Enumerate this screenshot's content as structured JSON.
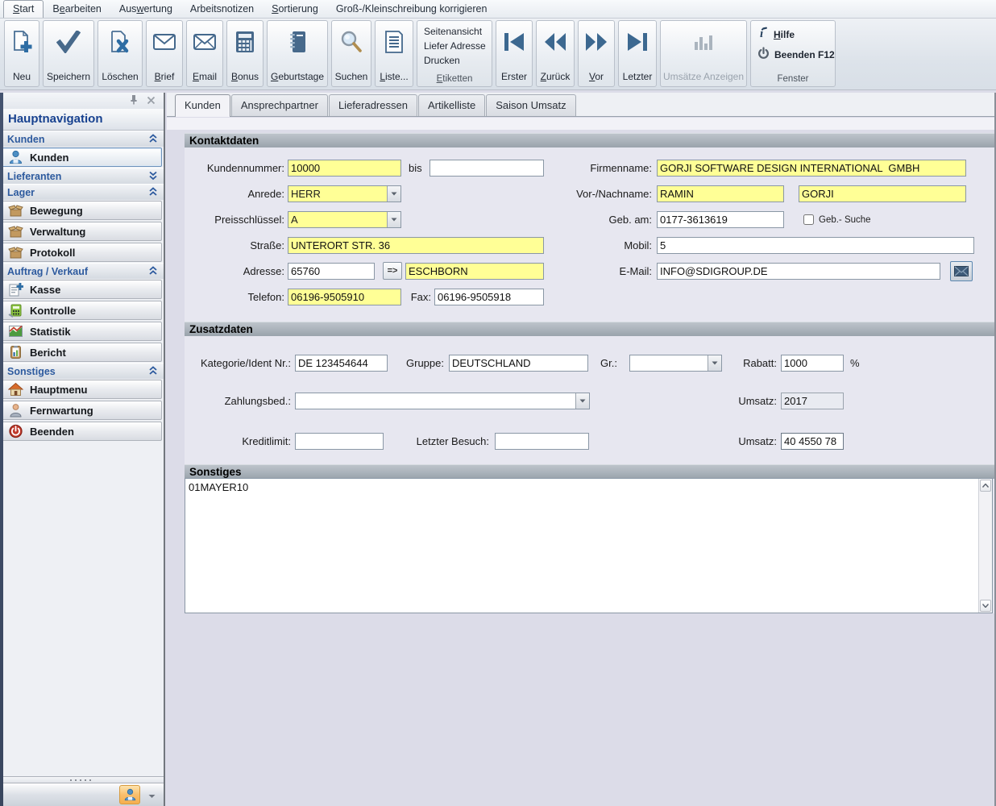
{
  "menubar": {
    "tabs": [
      {
        "pre": "",
        "u": "S",
        "post": "tart"
      },
      {
        "pre": "B",
        "u": "e",
        "post": "arbeiten"
      },
      {
        "pre": "Aus",
        "u": "w",
        "post": "ertung"
      },
      {
        "pre": "Arbeitsnotizen",
        "u": "",
        "post": ""
      },
      {
        "pre": "",
        "u": "S",
        "post": "ortierung"
      },
      {
        "pre": "Groß-/Kleinschreibung korrigieren",
        "u": "",
        "post": ""
      }
    ]
  },
  "ribbon": {
    "buttons": [
      {
        "pre": "Neu",
        "u": "",
        "post": ""
      },
      {
        "pre": "Speichern",
        "u": "",
        "post": ""
      },
      {
        "pre": "Löschen",
        "u": "",
        "post": ""
      },
      {
        "pre": "",
        "u": "B",
        "post": "rief"
      },
      {
        "pre": "",
        "u": "E",
        "post": "mail"
      },
      {
        "pre": "",
        "u": "B",
        "post": "onus"
      },
      {
        "pre": "",
        "u": "G",
        "post": "eburtstage"
      },
      {
        "pre": "Suchen",
        "u": "",
        "post": ""
      },
      {
        "pre": "",
        "u": "L",
        "post": "iste..."
      }
    ],
    "etiketten_group": {
      "items": [
        "Seitenansicht",
        "Liefer Adresse",
        "Drucken"
      ],
      "caption": {
        "pre": "",
        "u": "E",
        "post": "tiketten"
      }
    },
    "nav": [
      {
        "pre": "Erster",
        "u": "",
        "post": ""
      },
      {
        "pre": "",
        "u": "Z",
        "post": "urück"
      },
      {
        "pre": "",
        "u": "V",
        "post": "or"
      },
      {
        "pre": "Letzter",
        "u": "",
        "post": ""
      }
    ],
    "umsaetze_label": "Umsätze Anzeigen",
    "fenster_group": {
      "items": [
        {
          "pre": "",
          "u": "H",
          "post": "ilfe"
        },
        {
          "pre": "Beenden F12",
          "u": "",
          "post": ""
        }
      ],
      "caption": "Fenster"
    }
  },
  "sidebar": {
    "title": "Hauptnavigation",
    "groups": [
      {
        "header": "Kunden",
        "collapsed": false,
        "items": [
          {
            "label": "Kunden"
          }
        ]
      },
      {
        "header": "Lieferanten",
        "collapsed": true,
        "items": []
      },
      {
        "header": "Lager",
        "collapsed": false,
        "items": [
          {
            "label": "Bewegung"
          },
          {
            "label": "Verwaltung"
          },
          {
            "label": "Protokoll"
          }
        ]
      },
      {
        "header": "Auftrag / Verkauf",
        "collapsed": false,
        "items": [
          {
            "label": "Kasse"
          },
          {
            "label": "Kontrolle"
          },
          {
            "label": "Statistik"
          },
          {
            "label": "Bericht"
          }
        ]
      },
      {
        "header": "Sonstiges",
        "collapsed": false,
        "items": [
          {
            "label": "Hauptmenu"
          },
          {
            "label": "Fernwartung"
          },
          {
            "label": "Beenden"
          }
        ]
      }
    ]
  },
  "tabs": {
    "items": [
      "Kunden",
      "Ansprechpartner",
      "Lieferadressen",
      "Artikelliste",
      "Saison Umsatz"
    ],
    "active": "Kunden"
  },
  "form": {
    "sections": {
      "kontaktdaten": "Kontaktdaten",
      "zusatzdaten": "Zusatzdaten",
      "sonstiges": "Sonstiges"
    },
    "labels": {
      "kundennummer": "Kundennummer:",
      "bis": "bis",
      "anrede": "Anrede:",
      "preisschluessel": "Preisschlüssel:",
      "strasse": "Straße:",
      "adresse": "Adresse:",
      "telefon": "Telefon:",
      "fax": "Fax:",
      "firmenname": "Firmenname:",
      "vornachname": "Vor-/Nachname:",
      "gebam": "Geb. am:",
      "gebsuche": "Geb.- Suche",
      "mobil": "Mobil:",
      "email": "E-Mail:",
      "kategorie": "Kategorie/Ident Nr.:",
      "gruppe": "Gruppe:",
      "gr": "Gr.:",
      "rabatt": "Rabatt:",
      "percent": "%",
      "zahlungsbed": "Zahlungsbed.:",
      "umsatz": "Umsatz:",
      "kreditlimit": "Kreditlimit:",
      "letzterbesuch": "Letzter Besuch:",
      "arrow_button": "=>"
    },
    "values": {
      "kundennummer": "10000",
      "kundennummer_bis": "",
      "anrede": "HERR",
      "preisschluessel": "A",
      "strasse": "UNTERORT STR. 36",
      "plz": "65760",
      "ort": "ESCHBORN",
      "telefon": "06196-9505910",
      "fax": "06196-9505918",
      "firmenname": "GORJI SOFTWARE DESIGN INTERNATIONAL  GMBH",
      "vorname": "RAMIN",
      "nachname": "GORJI",
      "gebam": "0177-3613619",
      "mobil": "5",
      "email": "INFO@SDIGROUP.DE",
      "kategorie": "DE 123454644",
      "gruppe": "DEUTSCHLAND",
      "gr": "",
      "rabatt": "1000",
      "zahlungsbed": "",
      "umsatz_jahr": "2017",
      "kreditlimit": "",
      "letzter_besuch": "",
      "umsatz_betrag": "40 4550 78",
      "sonstiges_text": "01MAYER10"
    }
  },
  "colors": {
    "field_highlight": "#ffff96",
    "icon_blue": "#3c6890",
    "nav_blue": "#2d5a9e",
    "title_blue": "#17418f"
  }
}
